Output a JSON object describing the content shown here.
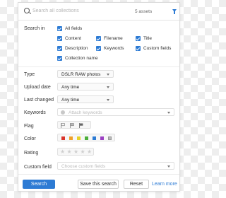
{
  "search": {
    "placeholder": "Search all collections",
    "asset_count": "5 assets"
  },
  "search_in": {
    "label": "Search in",
    "options": [
      {
        "label": "All fields",
        "checked": true
      },
      {
        "label": "Content",
        "checked": true
      },
      {
        "label": "Filename",
        "checked": true
      },
      {
        "label": "Title",
        "checked": true
      },
      {
        "label": "Description",
        "checked": true
      },
      {
        "label": "Keywords",
        "checked": true
      },
      {
        "label": "Custom fields",
        "checked": true
      },
      {
        "label": "Collection name",
        "checked": true
      }
    ]
  },
  "type": {
    "label": "Type",
    "value": "DSLR RAW photos"
  },
  "upload_date": {
    "label": "Upload date",
    "value": "Any time"
  },
  "last_changed": {
    "label": "Last changed",
    "value": "Any time"
  },
  "keywords": {
    "label": "Keywords",
    "placeholder": "Attach keywords"
  },
  "flag": {
    "label": "Flag",
    "icons": [
      "flag-outline-icon",
      "flag-striped-icon",
      "flag-filled-icon"
    ]
  },
  "color": {
    "label": "Color",
    "swatches": [
      "#d9342b",
      "#f0a02a",
      "#e6d229",
      "#4caf3a",
      "#2d7bd4",
      "#9b3fc2",
      "#b8b8b8"
    ]
  },
  "rating": {
    "label": "Rating",
    "stars": 5,
    "value": 0
  },
  "custom_field": {
    "label": "Custom field",
    "placeholder": "Choose custom fields"
  },
  "buttons": {
    "search": "Search",
    "save_search": "Save this search",
    "reset": "Reset",
    "learn_more": "Learn more"
  }
}
